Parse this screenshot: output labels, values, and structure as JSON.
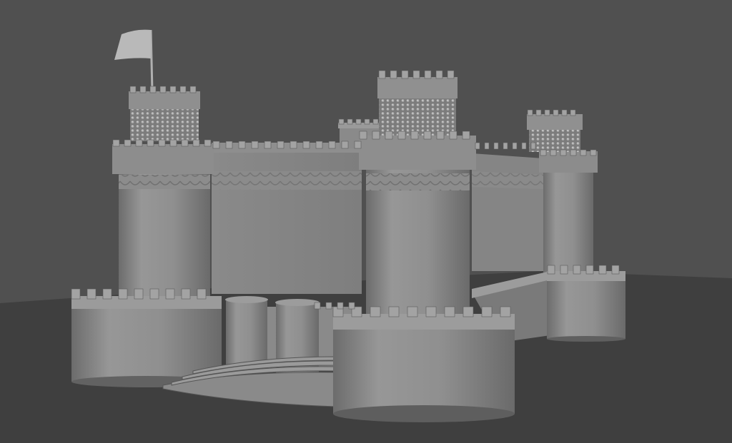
{
  "scene": {
    "description_visible_text": "",
    "colors": {
      "background": "#505050",
      "ground": "#3e3e3e",
      "stone_light": "#9a9a9a",
      "stone_mid": "#8a8a8a",
      "stone_dark": "#6e6e6e",
      "stone_shadow": "#5a5a5a",
      "outline": "#3a3a3a"
    }
  }
}
